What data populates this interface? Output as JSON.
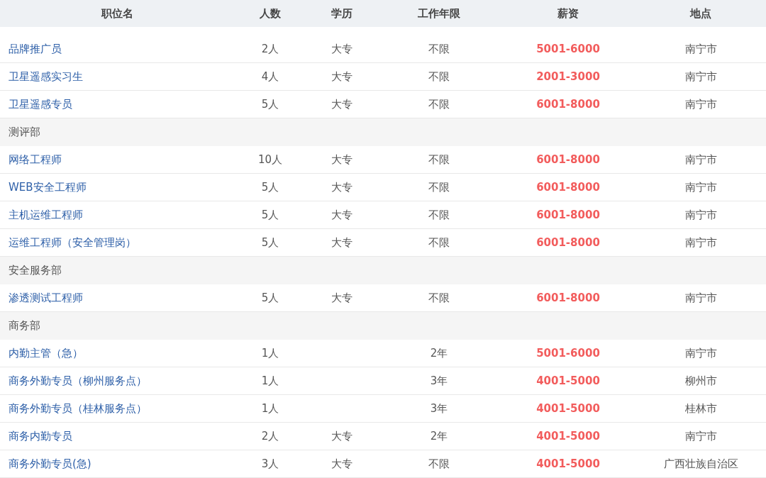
{
  "table": {
    "columns": [
      "职位名",
      "人数",
      "学历",
      "工作年限",
      "薪资",
      "地点"
    ],
    "rows": [
      {
        "kind": "job",
        "title": "品牌推广员",
        "count": "2人",
        "education": "大专",
        "experience": "不限",
        "salary": "5001-6000",
        "location": "南宁市"
      },
      {
        "kind": "job",
        "title": "卫星遥感实习生",
        "count": "4人",
        "education": "大专",
        "experience": "不限",
        "salary": "2001-3000",
        "location": "南宁市"
      },
      {
        "kind": "job",
        "title": "卫星遥感专员",
        "count": "5人",
        "education": "大专",
        "experience": "不限",
        "salary": "6001-8000",
        "location": "南宁市"
      },
      {
        "kind": "department",
        "title": "测评部"
      },
      {
        "kind": "job",
        "title": "网络工程师",
        "count": "10人",
        "education": "大专",
        "experience": "不限",
        "salary": "6001-8000",
        "location": "南宁市"
      },
      {
        "kind": "job",
        "title": "WEB安全工程师",
        "count": "5人",
        "education": "大专",
        "experience": "不限",
        "salary": "6001-8000",
        "location": "南宁市"
      },
      {
        "kind": "job",
        "title": "主机运维工程师",
        "count": "5人",
        "education": "大专",
        "experience": "不限",
        "salary": "6001-8000",
        "location": "南宁市"
      },
      {
        "kind": "job",
        "title": "运维工程师（安全管理岗）",
        "count": "5人",
        "education": "大专",
        "experience": "不限",
        "salary": "6001-8000",
        "location": "南宁市"
      },
      {
        "kind": "department",
        "title": "安全服务部"
      },
      {
        "kind": "job",
        "title": "渗透测试工程师",
        "count": "5人",
        "education": "大专",
        "experience": "不限",
        "salary": "6001-8000",
        "location": "南宁市"
      },
      {
        "kind": "department",
        "title": "商务部"
      },
      {
        "kind": "job",
        "title": "内勤主管（急）",
        "count": "1人",
        "experience": "2年",
        "salary": "5001-6000",
        "location": "南宁市"
      },
      {
        "kind": "job",
        "title": "商务外勤专员（柳州服务点）",
        "count": "1人",
        "experience": "3年",
        "salary": "4001-5000",
        "location": "柳州市"
      },
      {
        "kind": "job",
        "title": "商务外勤专员（桂林服务点）",
        "count": "1人",
        "experience": "3年",
        "salary": "4001-5000",
        "location": "桂林市"
      },
      {
        "kind": "job",
        "title": "商务内勤专员",
        "count": "2人",
        "education": "大专",
        "experience": "2年",
        "salary": "4001-5000",
        "location": "南宁市"
      },
      {
        "kind": "job",
        "title": "商务外勤专员(急)",
        "count": "3人",
        "education": "大专",
        "experience": "不限",
        "salary": "4001-5000",
        "location": "广西壮族自治区"
      }
    ]
  }
}
